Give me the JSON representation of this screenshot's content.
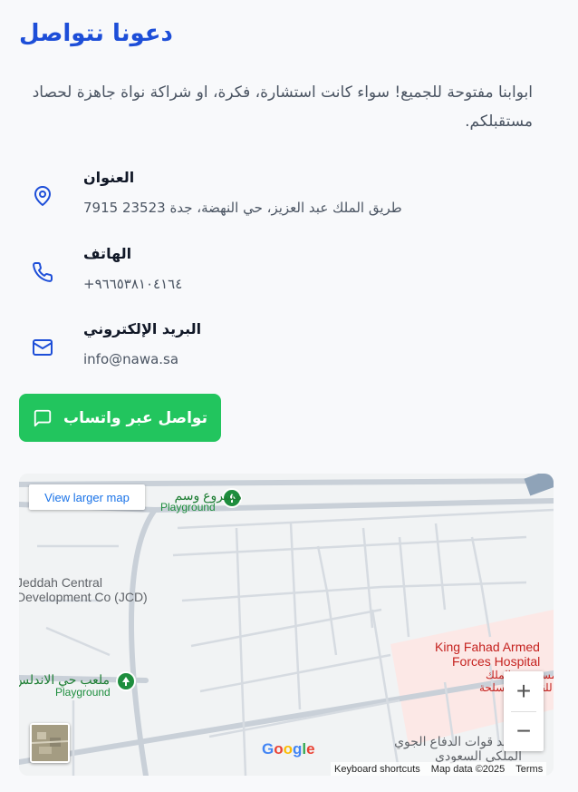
{
  "heading": "دعونا نتواصل",
  "description": "ابوابنا مفتوحة للجميع! سواء كانت استشارة، فكرة، او شراكة نواة جاهزة لحصاد مستقبلكم.",
  "contact": [
    {
      "label": "العنوان",
      "value": "طريق الملك عبد العزيز، حي النهضة، جدة 23523 7915",
      "icon": "map-pin-icon"
    },
    {
      "label": "الهاتف",
      "value": "+٩٦٦٥٣٨١٠٤١٦٤",
      "icon": "phone-icon"
    },
    {
      "label": "البريد الإلكتروني",
      "value": "info@nawa.sa",
      "icon": "mail-icon"
    }
  ],
  "whatsapp_button": "تواصل عبر واتساب",
  "colors": {
    "primary": "#1d4ed8",
    "whatsapp": "#22c55e"
  },
  "map": {
    "view_larger": "View larger map",
    "zoom_in": "+",
    "zoom_out": "−",
    "labels": {
      "project_name": "مشروع وسم",
      "playground": "Playground",
      "jcd_line1": "Jeddah Central",
      "jcd_line2": "Development Co (JCD)",
      "hospital_line1": "King Fahad Armed",
      "hospital_line2": "Forces Hospital",
      "hospital_ar_line1": "مستشفى الملك",
      "hospital_ar_line2": "للقوات المسلحة",
      "andalus_playground": "ملعب حي الاندلس",
      "playground2": "Playground",
      "air_force_line1": "معهد قوات الدفاع الجوي",
      "air_force_line2": "الملكي السعودي"
    },
    "google": "Google",
    "attribution": {
      "shortcuts": "Keyboard shortcuts",
      "data": "Map data ©2025",
      "terms": "Terms"
    }
  }
}
